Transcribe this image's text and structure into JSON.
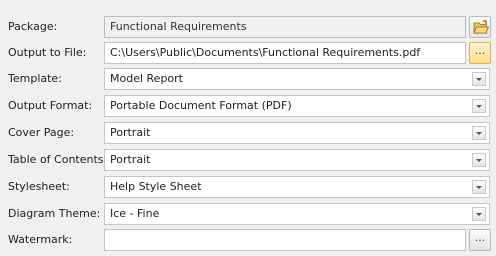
{
  "fields": {
    "package": {
      "label": "Package:",
      "value": "Functional Requirements"
    },
    "output_file": {
      "label": "Output to File:",
      "value": "C:\\Users\\Public\\Documents\\Functional Requirements.pdf",
      "browse_label": "..."
    },
    "template": {
      "label": "Template:",
      "value": "Model Report"
    },
    "output_format": {
      "label": "Output Format:",
      "value": "Portable Document Format (PDF)"
    },
    "cover_page": {
      "label": "Cover Page:",
      "value": "Portrait"
    },
    "table_of_contents": {
      "label": "Table of Contents:",
      "value": "Portrait"
    },
    "stylesheet": {
      "label": "Stylesheet:",
      "value": "Help Style Sheet"
    },
    "diagram_theme": {
      "label": "Diagram Theme:",
      "value": "Ice - Fine"
    },
    "watermark": {
      "label": "Watermark:",
      "value": "",
      "browse_label": "..."
    }
  },
  "icons": {
    "package_select": "folder-open-icon"
  },
  "colors": {
    "active_button": "#fde08a",
    "background": "#f0f0f0"
  }
}
